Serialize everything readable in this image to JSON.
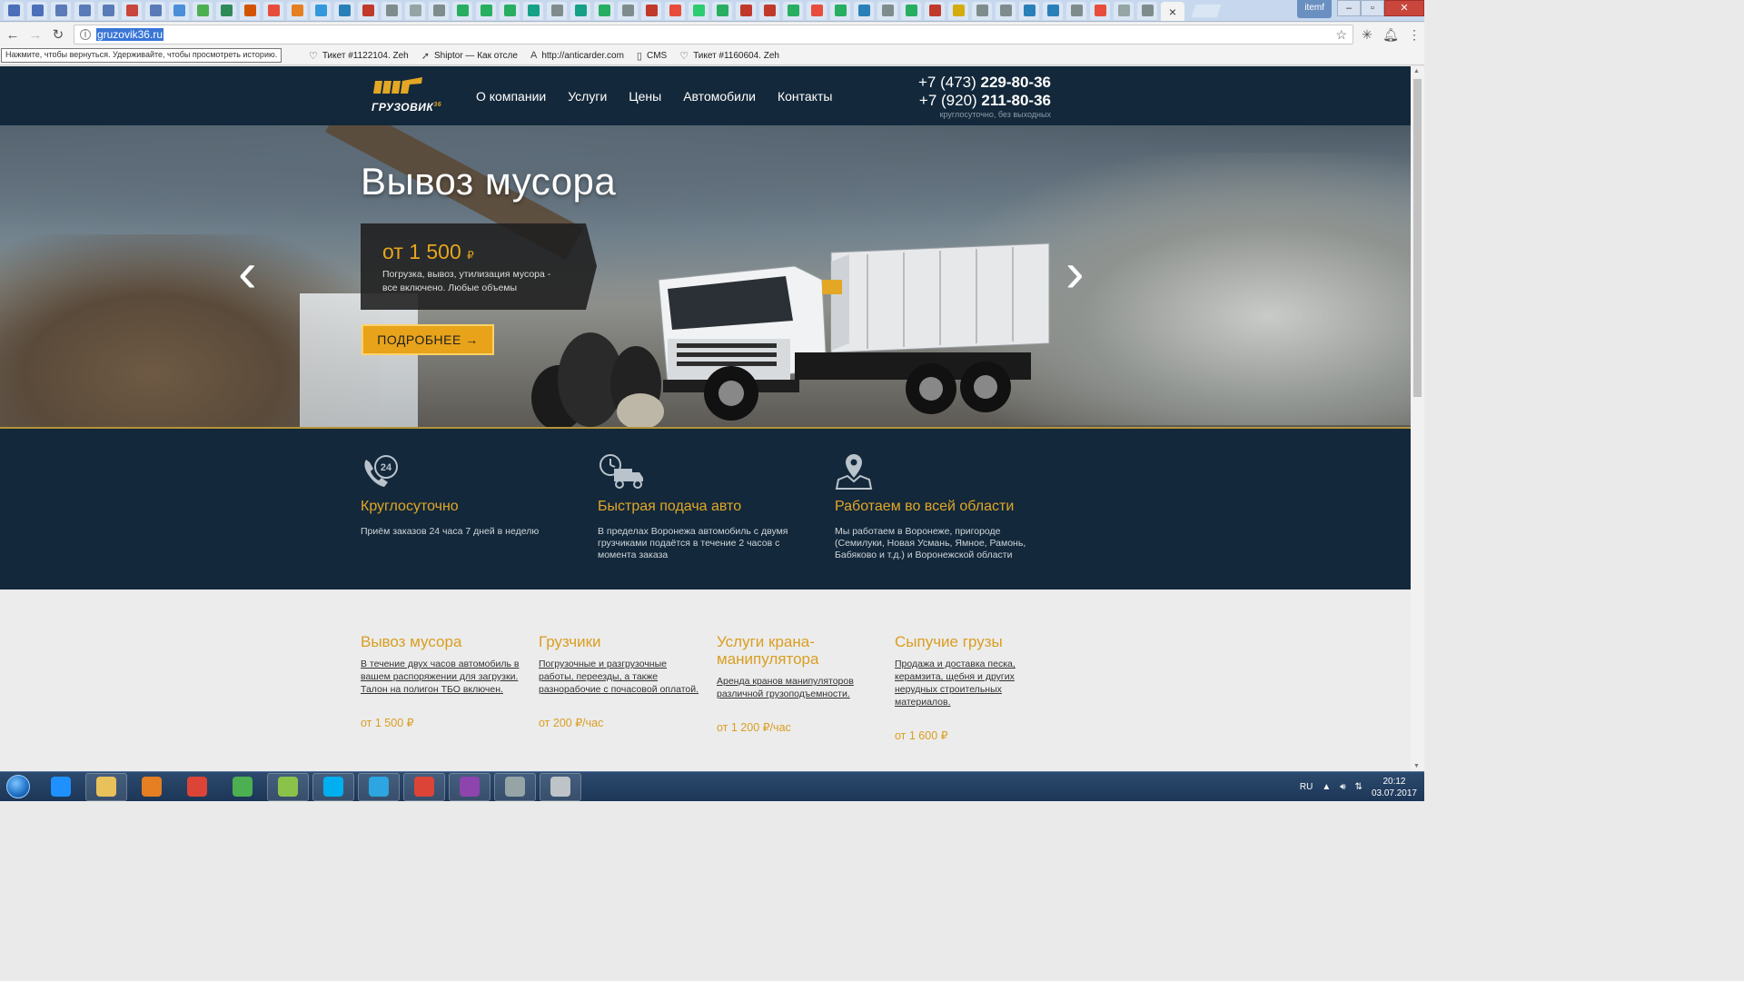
{
  "browser": {
    "url": "gruzovik36.ru",
    "tooltip": "Нажмите, чтобы вернуться. Удерживайте, чтобы просмотреть историю.",
    "active_tab_close": "×",
    "user_label": "itemf",
    "bookmarks": [
      {
        "icon": "heart-icon",
        "glyph": "♡",
        "label": "Тикет #1122104. Zeh"
      },
      {
        "icon": "arrow-icon",
        "glyph": "➚",
        "label": "Shiptor — Как отсле"
      },
      {
        "icon": "a-icon",
        "glyph": "A",
        "label": "http://anticarder.com"
      },
      {
        "icon": "page-icon",
        "glyph": "▯",
        "label": "CMS"
      },
      {
        "icon": "heart-icon",
        "glyph": "♡",
        "label": "Тикет #1160604. Zeh"
      }
    ],
    "tab_colors": [
      "#4b6fb8",
      "#4b6fb8",
      "#5a7bb7",
      "#5a7bb7",
      "#5a7bb7",
      "#c8463d",
      "#5a7bb7",
      "#4a8fd8",
      "#4caf50",
      "#2e8b57",
      "#d35400",
      "#e74c3c",
      "#e67e22",
      "#3498db",
      "#2980b9",
      "#c0392b",
      "#7f8c8d",
      "#95a5a6",
      "#7f8c8d",
      "#27ae60",
      "#27ae60",
      "#27ae60",
      "#16a085",
      "#7f8c8d",
      "#16a085",
      "#27ae60",
      "#7f8c8d",
      "#c0392b",
      "#e74c3c",
      "#2ecc71",
      "#27ae60",
      "#c0392b",
      "#c0392b",
      "#27ae60",
      "#e74c3c",
      "#27ae60",
      "#2980b9",
      "#7f8c8d",
      "#27ae60",
      "#c0392b",
      "#d4ac0d",
      "#7f8c8d",
      "#7f8c8d",
      "#2980b9",
      "#2980b9",
      "#7f8c8d",
      "#e74c3c",
      "#95a5a6",
      "#7f8c8d"
    ]
  },
  "header": {
    "logo_text": "ГРУЗОВИК",
    "logo_sup": "36",
    "nav": [
      "О компании",
      "Услуги",
      "Цены",
      "Автомобили",
      "Контакты"
    ],
    "phone1_prefix": "+7 (473) ",
    "phone1_number": "229-80-36",
    "phone2_prefix": "+7 (920) ",
    "phone2_number": "211-80-36",
    "hours": "круглосуточно, без выходных"
  },
  "hero": {
    "title": "Вывоз мусора",
    "price": "от 1 500",
    "currency": "₽",
    "description": "Погрузка, вывоз, утилизация мусора - все включено. Любые объемы",
    "button": "ПОДРОБНЕЕ →",
    "prev": "‹",
    "next": "›"
  },
  "features": [
    {
      "icon": "24h-phone-icon",
      "title": "Круглосуточно",
      "text": "Приём заказов 24 часа 7 дней в неделю"
    },
    {
      "icon": "clock-truck-icon",
      "title": "Быстрая подача авто",
      "text": "В пределах Воронежа автомобиль с двумя грузчиками подаётся в течение 2 часов с момента заказа"
    },
    {
      "icon": "map-pin-icon",
      "title": "Работаем во всей области",
      "text": "Мы работаем в Воронеже, пригороде (Семилуки, Новая Усмань, Ямное, Рамонь, Бабяково и т.д.) и Воронежской области"
    }
  ],
  "services": [
    {
      "title": "Вывоз мусора",
      "text": "В течение двух часов автомобиль в вашем распоряжении для загрузки. Талон на полигон ТБО включен.",
      "price": "от 1 500 ₽"
    },
    {
      "title": "Грузчики",
      "text": "Погрузочные и разгрузочные работы, переезды, а также разнорабочие с почасовой оплатой.",
      "price": "от 200 ₽/час"
    },
    {
      "title": "Услуги крана-манипулятора",
      "text": "Аренда кранов манипуляторов различной грузоподъемности.",
      "price": "от 1 200 ₽/час"
    },
    {
      "title": "Сыпучие грузы",
      "text": "Продажа и доставка песка, керамзита, щебня и других нерудных строительных материалов.",
      "price": "от 1 600 ₽"
    }
  ],
  "taskbar": {
    "apps": [
      {
        "icon": "ie-icon",
        "color": "#1e90ff",
        "open": false
      },
      {
        "icon": "explorer-icon",
        "color": "#e8c15a",
        "open": true
      },
      {
        "icon": "media-player-icon",
        "color": "#e67e22",
        "open": false
      },
      {
        "icon": "chrome-icon",
        "color": "#db4437",
        "open": false
      },
      {
        "icon": "icq-icon",
        "color": "#4caf50",
        "open": false
      },
      {
        "icon": "talk-icon",
        "color": "#8bc34a",
        "open": true
      },
      {
        "icon": "skype-icon",
        "color": "#00aff0",
        "open": true
      },
      {
        "icon": "telegram-icon",
        "color": "#2ca5e0",
        "open": true
      },
      {
        "icon": "chrome-active-icon",
        "color": "#db4437",
        "open": true
      },
      {
        "icon": "winrar-icon",
        "color": "#8e44ad",
        "open": true
      },
      {
        "icon": "calculator-icon",
        "color": "#95a5a6",
        "open": true
      },
      {
        "icon": "tools-icon",
        "color": "#bdc3c7",
        "open": true
      }
    ],
    "lang": "RU",
    "time": "20:12",
    "date": "03.07.2017"
  }
}
